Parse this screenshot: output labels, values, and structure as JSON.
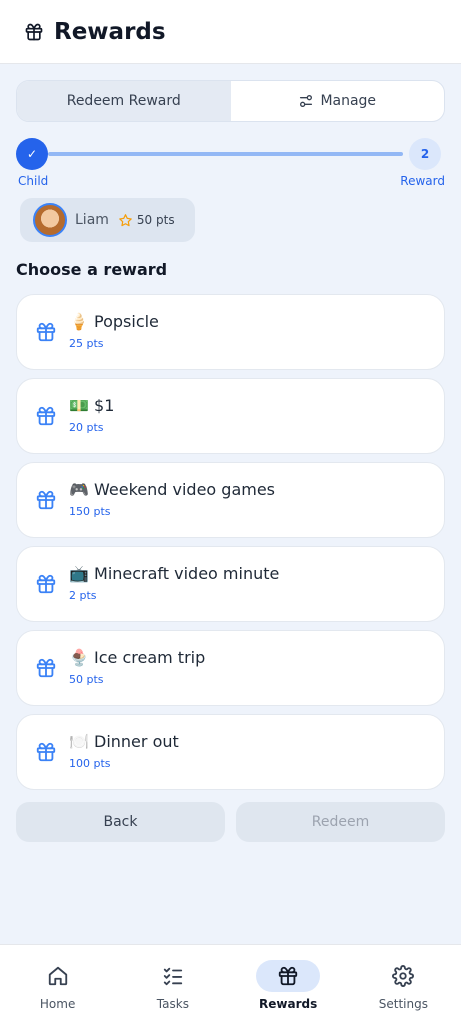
{
  "header": {
    "title": "Rewards",
    "icon": "gift-icon"
  },
  "segment": {
    "options": [
      {
        "label": "Redeem Reward",
        "active": true
      },
      {
        "label": "Manage",
        "active": false,
        "icon": "sliders-icon"
      }
    ]
  },
  "stepper": {
    "steps": [
      {
        "marker": "✓",
        "label": "Child",
        "state": "done"
      },
      {
        "marker": "2",
        "label": "Reward",
        "state": "current"
      }
    ]
  },
  "selected_child": {
    "name": "Liam",
    "points": "50 pts"
  },
  "section_title": "Choose a reward",
  "rewards": [
    {
      "name": "🍦 Popsicle",
      "points": "25 pts"
    },
    {
      "name": "💵 $1",
      "points": "20 pts"
    },
    {
      "name": "🎮 Weekend video games",
      "points": "150 pts"
    },
    {
      "name": "📺 Minecraft video minute",
      "points": "2 pts"
    },
    {
      "name": "🍨 Ice cream trip",
      "points": "50 pts"
    },
    {
      "name": "🍽️ Dinner out",
      "points": "100 pts"
    }
  ],
  "actions": {
    "back": "Back",
    "redeem": "Redeem",
    "redeem_disabled": true
  },
  "tabbar": {
    "tabs": [
      {
        "label": "Home",
        "icon": "home-icon"
      },
      {
        "label": "Tasks",
        "icon": "checklist-icon"
      },
      {
        "label": "Rewards",
        "icon": "gift-icon",
        "active": true
      },
      {
        "label": "Settings",
        "icon": "gear-icon"
      }
    ]
  },
  "colors": {
    "accent": "#2563eb",
    "background": "#eef3fb",
    "star": "#f59e0b"
  }
}
